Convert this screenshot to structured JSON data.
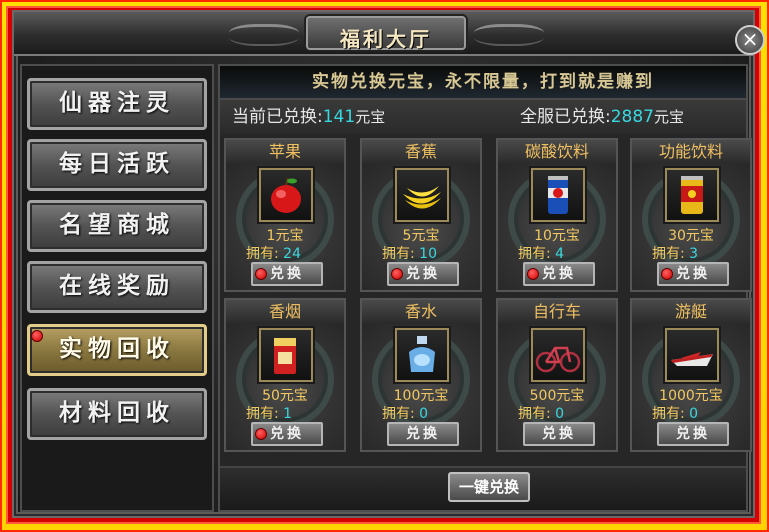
{
  "window": {
    "title": "福利大厅",
    "close_label": "×"
  },
  "sidebar": {
    "items": [
      {
        "label": "仙器注灵",
        "active": false,
        "dot": false
      },
      {
        "label": "每日活跃",
        "active": false,
        "dot": false
      },
      {
        "label": "名望商城",
        "active": false,
        "dot": false
      },
      {
        "label": "在线奖励",
        "active": false,
        "dot": false
      },
      {
        "label": "实物回收",
        "active": true,
        "dot": true
      },
      {
        "label": "材料回收",
        "active": false,
        "dot": false
      }
    ]
  },
  "banner": "实物兑换元宝，永不限量，打到就是赚到",
  "stats": {
    "current_label": "当前已兑换:",
    "current_value": "141",
    "current_unit": "元宝",
    "server_label": "全服已兑换:",
    "server_value": "2887",
    "server_unit": "元宝"
  },
  "owned_label": "拥有:",
  "exchange_label": "兑换",
  "items": [
    {
      "name": "苹果",
      "price": "1元宝",
      "owned": "24",
      "dot": true,
      "icon": "apple-icon"
    },
    {
      "name": "香蕉",
      "price": "5元宝",
      "owned": "10",
      "dot": true,
      "icon": "banana-icon"
    },
    {
      "name": "碳酸饮料",
      "price": "10元宝",
      "owned": "4",
      "dot": true,
      "icon": "soda-can-icon"
    },
    {
      "name": "功能饮料",
      "price": "30元宝",
      "owned": "3",
      "dot": true,
      "icon": "energy-drink-icon"
    },
    {
      "name": "香烟",
      "price": "50元宝",
      "owned": "1",
      "dot": true,
      "icon": "cigarette-pack-icon"
    },
    {
      "name": "香水",
      "price": "100元宝",
      "owned": "0",
      "dot": false,
      "icon": "perfume-bottle-icon"
    },
    {
      "name": "自行车",
      "price": "500元宝",
      "owned": "0",
      "dot": false,
      "icon": "bicycle-icon"
    },
    {
      "name": "游艇",
      "price": "1000元宝",
      "owned": "0",
      "dot": false,
      "icon": "yacht-icon"
    }
  ],
  "one_key_label": "一键兑换",
  "colors": {
    "accent_gold": "#f2c860",
    "value_cyan": "#39d8e0",
    "frame_red": "#d70000",
    "frame_yellow": "#ffd200"
  }
}
